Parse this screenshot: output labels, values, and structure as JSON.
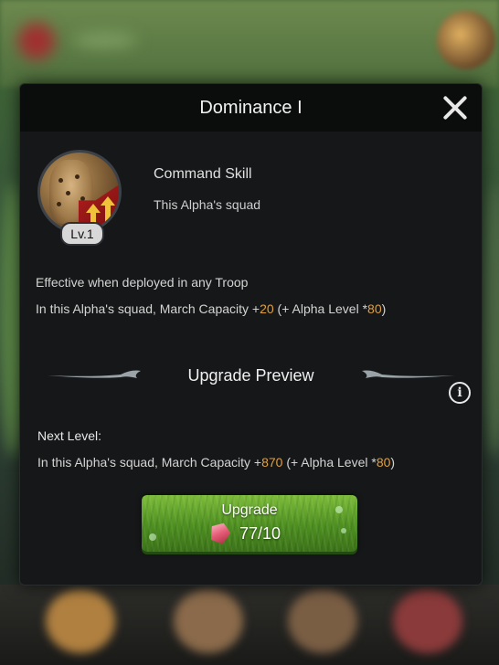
{
  "dialog": {
    "title": "Dominance I"
  },
  "skill": {
    "level_label": "Lv.1",
    "type": "Command Skill",
    "target": "This Alpha's squad"
  },
  "current_effect": {
    "condition": "Effective when deployed in any Troop",
    "prefix": "In this Alpha's squad, March Capacity +",
    "value": "20",
    "middle": " (+ Alpha Level *",
    "multiplier": "80",
    "suffix": ")"
  },
  "preview": {
    "title": "Upgrade Preview",
    "next_level_label": "Next Level:",
    "prefix": "In this Alpha's squad, March Capacity +",
    "value": "870",
    "middle": " (+ Alpha Level *",
    "multiplier": "80",
    "suffix": ")"
  },
  "upgrade_button": {
    "label": "Upgrade",
    "cost": "77/10",
    "cost_icon": "gem-icon"
  },
  "info_icon_glyph": "i",
  "colors": {
    "panel_bg": "#151718",
    "header_bg": "#0b0c0c",
    "highlight_number": "#e0a040",
    "button_green": "#5a9e2a"
  }
}
